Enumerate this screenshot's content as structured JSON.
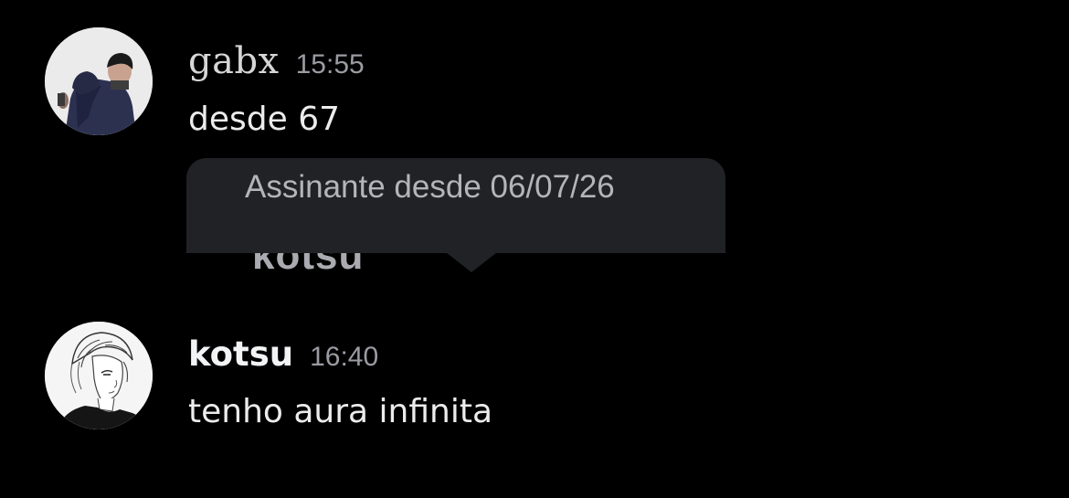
{
  "messages": [
    {
      "username": "gabx",
      "timestamp": "15:55",
      "text": "desde 67",
      "avatar_icon": "dark-photo-avatar"
    },
    {
      "username": "kotsu",
      "timestamp": "16:40",
      "text": "tenho aura infinita",
      "avatar_icon": "sketch-portrait-avatar"
    }
  ],
  "embed": {
    "tooltip_text": "Assinante desde 06/07/26",
    "cut_username": "kotsu"
  },
  "colors": {
    "background": "#000000",
    "tooltip": "#212226",
    "timestamp": "#9a9ca2"
  }
}
